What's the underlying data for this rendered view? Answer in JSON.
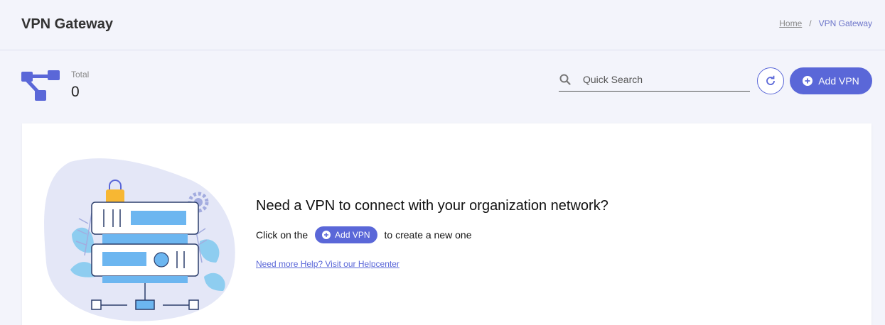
{
  "header": {
    "title": "VPN Gateway",
    "breadcrumb": {
      "home": "Home",
      "separator": "/",
      "current": "VPN Gateway"
    }
  },
  "stats": {
    "label": "Total",
    "value": "0",
    "icon": "network-nodes-icon"
  },
  "search": {
    "placeholder": "Quick Search",
    "value": "",
    "icon": "search-icon"
  },
  "actions": {
    "refresh_icon": "refresh-icon",
    "add_label": "Add VPN",
    "add_icon": "plus-circle-icon"
  },
  "empty_state": {
    "heading": "Need a VPN to connect with your organization network?",
    "line_before": "Click on the",
    "inline_button": "Add VPN",
    "line_after": "to create a new one",
    "help_link": "Need more Help? Visit our Helpcenter"
  },
  "colors": {
    "accent": "#5a67d8",
    "background": "#f3f4fb",
    "card": "#ffffff"
  }
}
